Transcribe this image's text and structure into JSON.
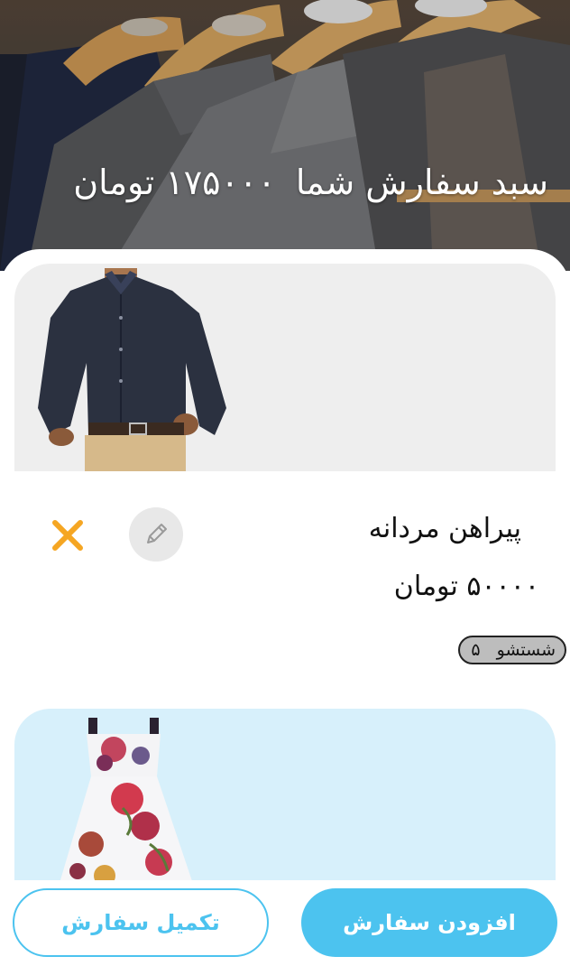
{
  "header": {
    "title": "سبد سفارش شما",
    "total": "۱۷۵۰۰۰ تومان"
  },
  "cart": {
    "items": [
      {
        "name": "پیراهن مردانه",
        "price": "۵۰۰۰۰ تومان",
        "service": "شستشو",
        "quantity": "۵",
        "image_icon": "mens-shirt-image"
      },
      {
        "image_icon": "floral-dress-image"
      }
    ]
  },
  "actions": {
    "add_order": "افزودن سفارش",
    "complete_order": "تکمیل سفارش"
  },
  "colors": {
    "accent": "#4cc3ef",
    "remove": "#f5a623",
    "card1_bg": "#eeeeee",
    "card2_bg": "#d7f0fb"
  },
  "icons": {
    "edit": "pencil-icon",
    "remove": "close-icon"
  }
}
